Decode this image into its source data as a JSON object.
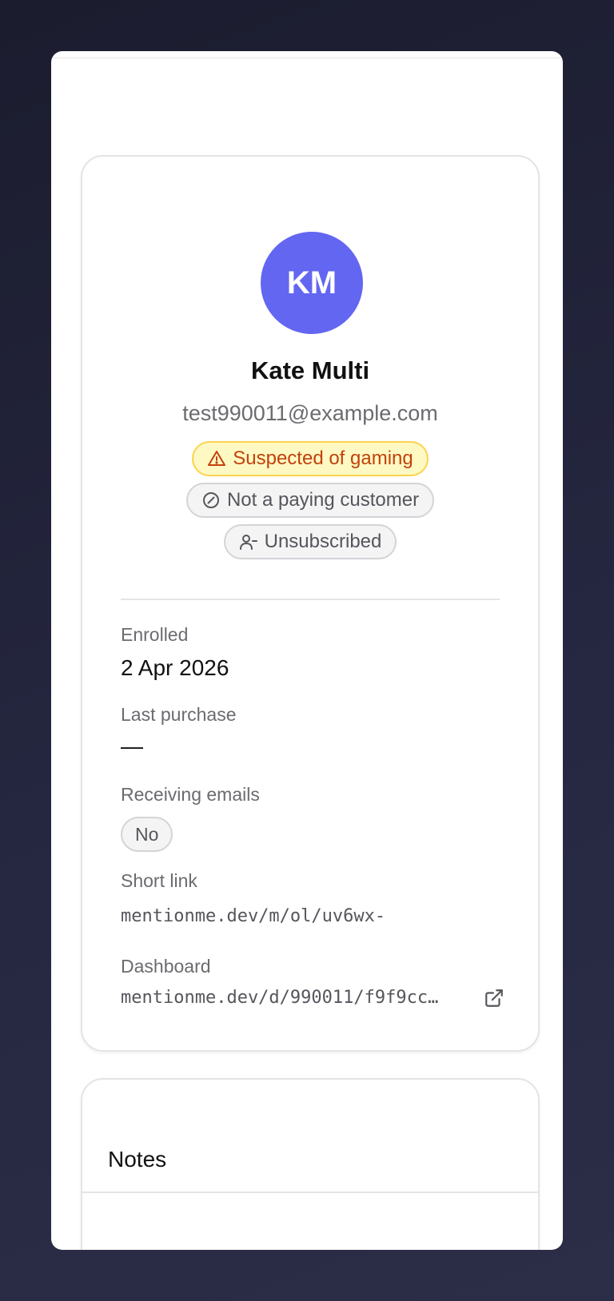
{
  "profile": {
    "initials": "KM",
    "avatar_color": "#6366f1",
    "name": "Kate Multi",
    "email": "test990011@example.com",
    "badges": [
      {
        "label": "Suspected of gaming",
        "icon": "warning-triangle-icon",
        "tone": "warning"
      },
      {
        "label": "Not a paying customer",
        "icon": "slash-circle-icon",
        "tone": "neutral"
      },
      {
        "label": "Unsubscribed",
        "icon": "user-minus-icon",
        "tone": "neutral"
      }
    ]
  },
  "details": {
    "enrolled_label": "Enrolled",
    "enrolled_value": "2 Apr 2026",
    "last_purchase_label": "Last purchase",
    "last_purchase_value": "—",
    "receiving_emails_label": "Receiving emails",
    "receiving_emails_value": "No",
    "short_link_label": "Short link",
    "short_link_value": "mentionme.dev/m/ol/uv6wx-",
    "dashboard_label": "Dashboard",
    "dashboard_value": "mentionme.dev/d/990011/f9f9cc…"
  },
  "notes": {
    "title": "Notes"
  },
  "colors": {
    "background": "#1f2035",
    "warning_bg": "#fef9c3",
    "warning_text": "#c2410c"
  }
}
